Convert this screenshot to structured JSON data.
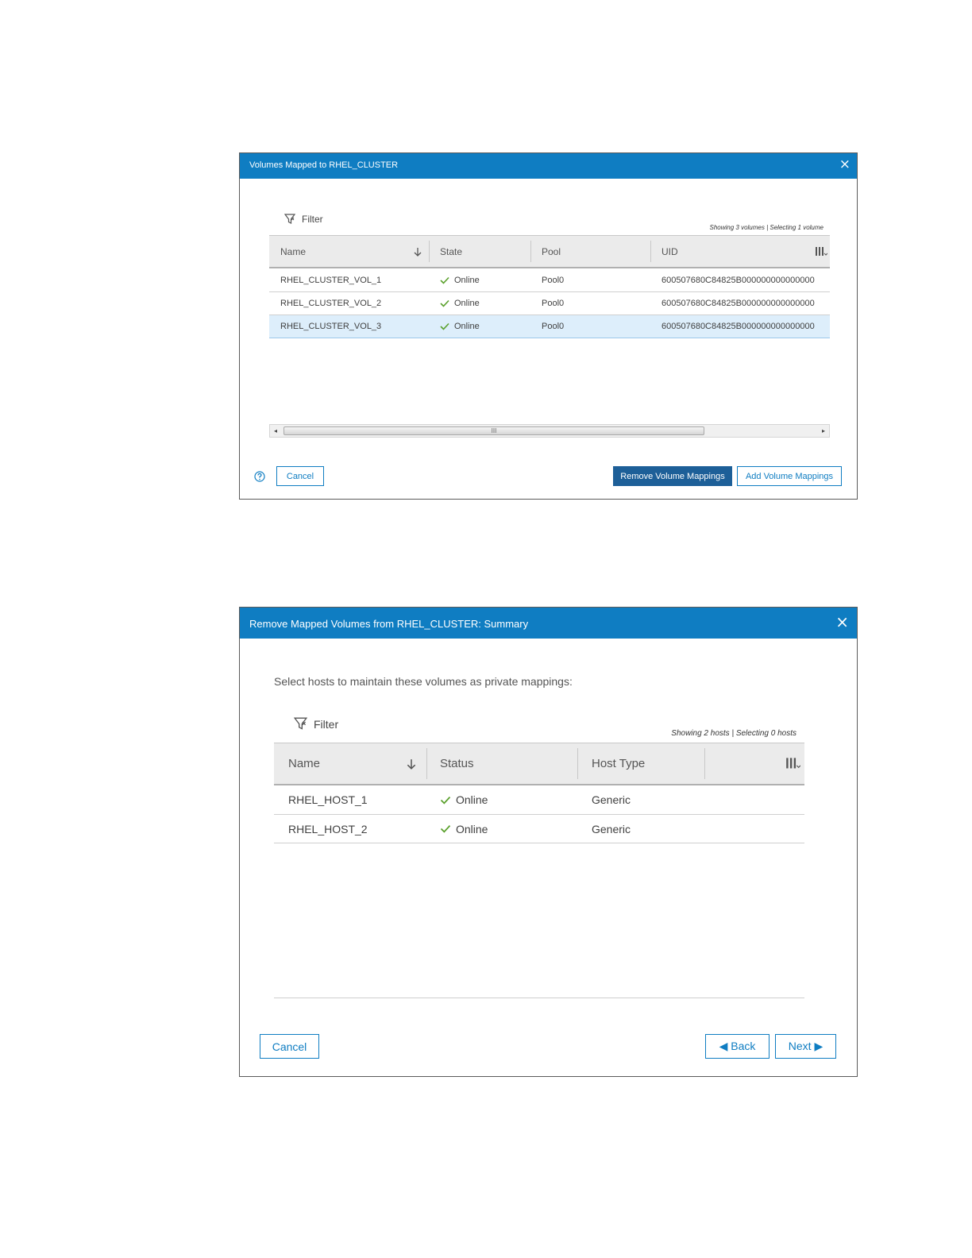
{
  "dialog1": {
    "title": "Volumes Mapped to RHEL_CLUSTER",
    "close_glyph": "×",
    "filter_label": "Filter",
    "summary": "Showing 3 volumes | Selecting 1 volume",
    "columns": [
      "Name",
      "State",
      "Pool",
      "UID"
    ],
    "rows": [
      {
        "name": "RHEL_CLUSTER_VOL_1",
        "state": "Online",
        "pool": "Pool0",
        "uid": "600507680C84825B000000000000000",
        "selected": false
      },
      {
        "name": "RHEL_CLUSTER_VOL_2",
        "state": "Online",
        "pool": "Pool0",
        "uid": "600507680C84825B000000000000000",
        "selected": false
      },
      {
        "name": "RHEL_CLUSTER_VOL_3",
        "state": "Online",
        "pool": "Pool0",
        "uid": "600507680C84825B000000000000000",
        "selected": true
      }
    ],
    "scroll_grip": "III",
    "scroll_left": "◂",
    "scroll_right": "▸",
    "buttons": {
      "cancel": "Cancel",
      "remove": "Remove Volume Mappings",
      "add": "Add Volume Mappings"
    }
  },
  "dialog2": {
    "title": "Remove Mapped Volumes from RHEL_CLUSTER: Summary",
    "close_glyph": "×",
    "instruction": "Select hosts to maintain these volumes as private mappings:",
    "filter_label": "Filter",
    "summary": "Showing 2 hosts | Selecting 0 hosts",
    "columns": [
      "Name",
      "Status",
      "Host Type"
    ],
    "rows": [
      {
        "name": "RHEL_HOST_1",
        "status": "Online",
        "host_type": "Generic"
      },
      {
        "name": "RHEL_HOST_2",
        "status": "Online",
        "host_type": "Generic"
      }
    ],
    "buttons": {
      "cancel": "Cancel",
      "back": "◀ Back",
      "next": "Next ▶"
    }
  },
  "colors": {
    "titlebar": "#0f7dc2",
    "primary_button": "#1d5f98",
    "online_check": "#5aa02c",
    "selected_row": "#ddeefb"
  },
  "icons": [
    "close-icon",
    "filter-icon",
    "sort-down-icon",
    "column-chooser-icon",
    "check-icon",
    "help-icon"
  ]
}
